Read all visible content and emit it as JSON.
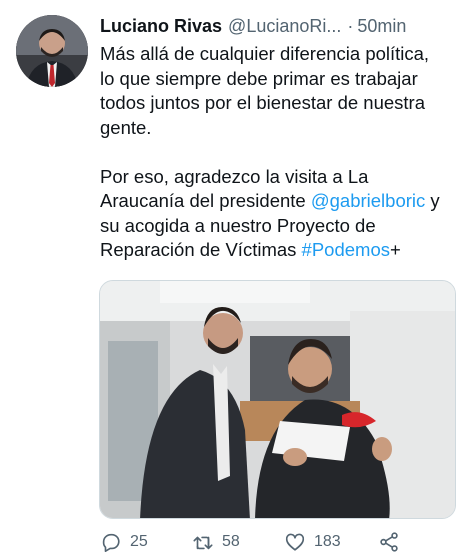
{
  "tweet": {
    "author_name": "Luciano Rivas",
    "author_handle": "@LucianoRi...",
    "separator": "·",
    "time": "50min",
    "text": {
      "line1": "Más allá de cualquier diferencia política,",
      "line2": "lo que siempre debe primar es trabajar",
      "line3": "todos juntos por el bienestar de nuestra",
      "line4": "gente.",
      "line5": "Por eso, agradezco la visita a La",
      "line6_a": "Araucanía del presidente ",
      "line6_mention": "@gabrielboric",
      "line6_b": " y",
      "line7": "su acogida a nuestro Proyecto de",
      "line8_a": "Reparación de Víctimas ",
      "line8_hashtag": "#Podemos",
      "line8_b": "+"
    },
    "actions": {
      "reply_count": "25",
      "retweet_count": "58",
      "like_count": "183"
    },
    "colors": {
      "link": "#1d9bf0",
      "secondary": "#536471",
      "text": "#0f1419"
    }
  }
}
